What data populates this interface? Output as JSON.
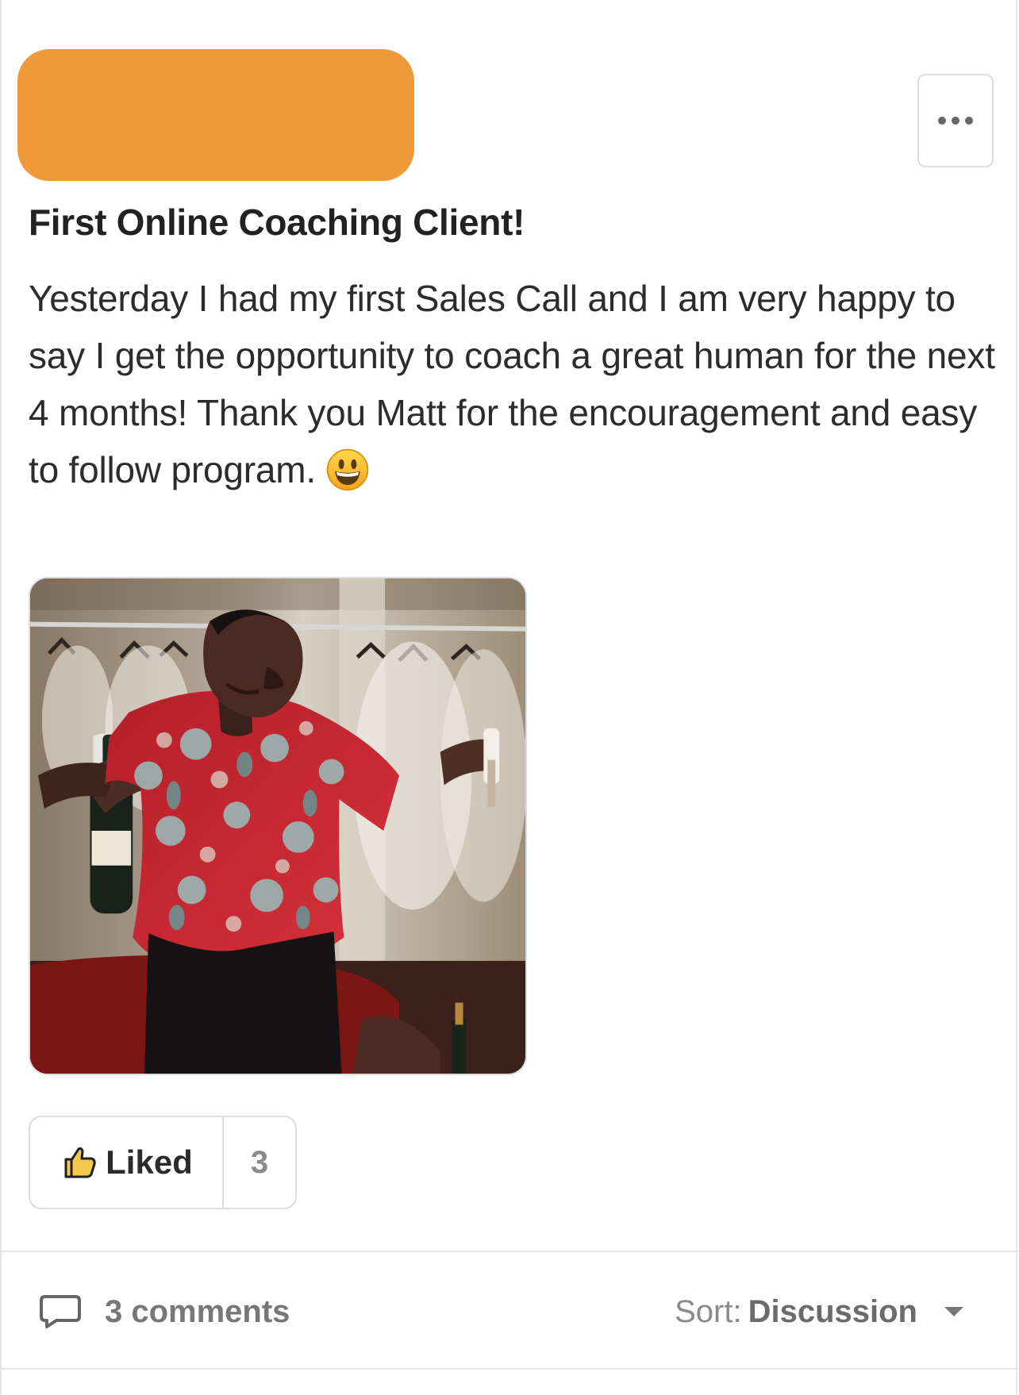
{
  "post": {
    "title": "First Online Coaching Client!",
    "body": "Yesterday I had my first Sales Call and I am very happy to say I get the opportunity to coach a great human for the next 4 months! Thank you Matt for the encouragement and easy to follow program.",
    "emoji_icon": "grinning-face-emoji-icon",
    "menu_icon": "more-options-icon",
    "gif_icon": "celebration-gif-image"
  },
  "actions": {
    "like_label": "Liked",
    "like_count": "3",
    "like_icon": "thumbs-up-icon"
  },
  "footer": {
    "comments_label": "3 comments",
    "comment_icon": "speech-bubble-icon",
    "sort_prefix": "Sort:",
    "sort_value": "Discussion",
    "sort_icon": "caret-down-icon"
  },
  "colors": {
    "redaction": "#f0993a",
    "text": "#2b2b2b",
    "border": "#dcdcdc",
    "muted": "#8a8a8a"
  }
}
